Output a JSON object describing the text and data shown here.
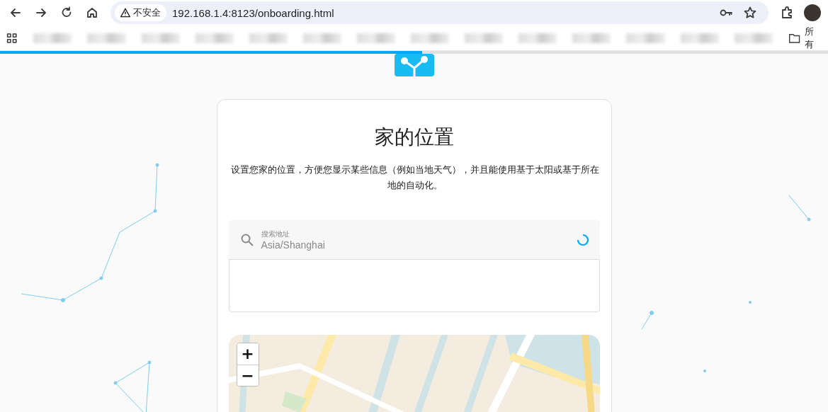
{
  "browser": {
    "security_label": "不安全",
    "address": "192.168.1.4:8123/onboarding.html",
    "bookmarks_folder": "所有"
  },
  "progress": {
    "level": 0.51
  },
  "card": {
    "title": "家的位置",
    "description": "设置您家的位置，方便您显示某些信息（例如当地天气），并且能使用基于太阳或基于所在地的自动化。",
    "search": {
      "label": "搜索地址",
      "value": "Asia/Shanghai",
      "loading": true
    },
    "map": {
      "kind": "picture",
      "zoom_in": "+",
      "zoom_out": "−"
    }
  }
}
